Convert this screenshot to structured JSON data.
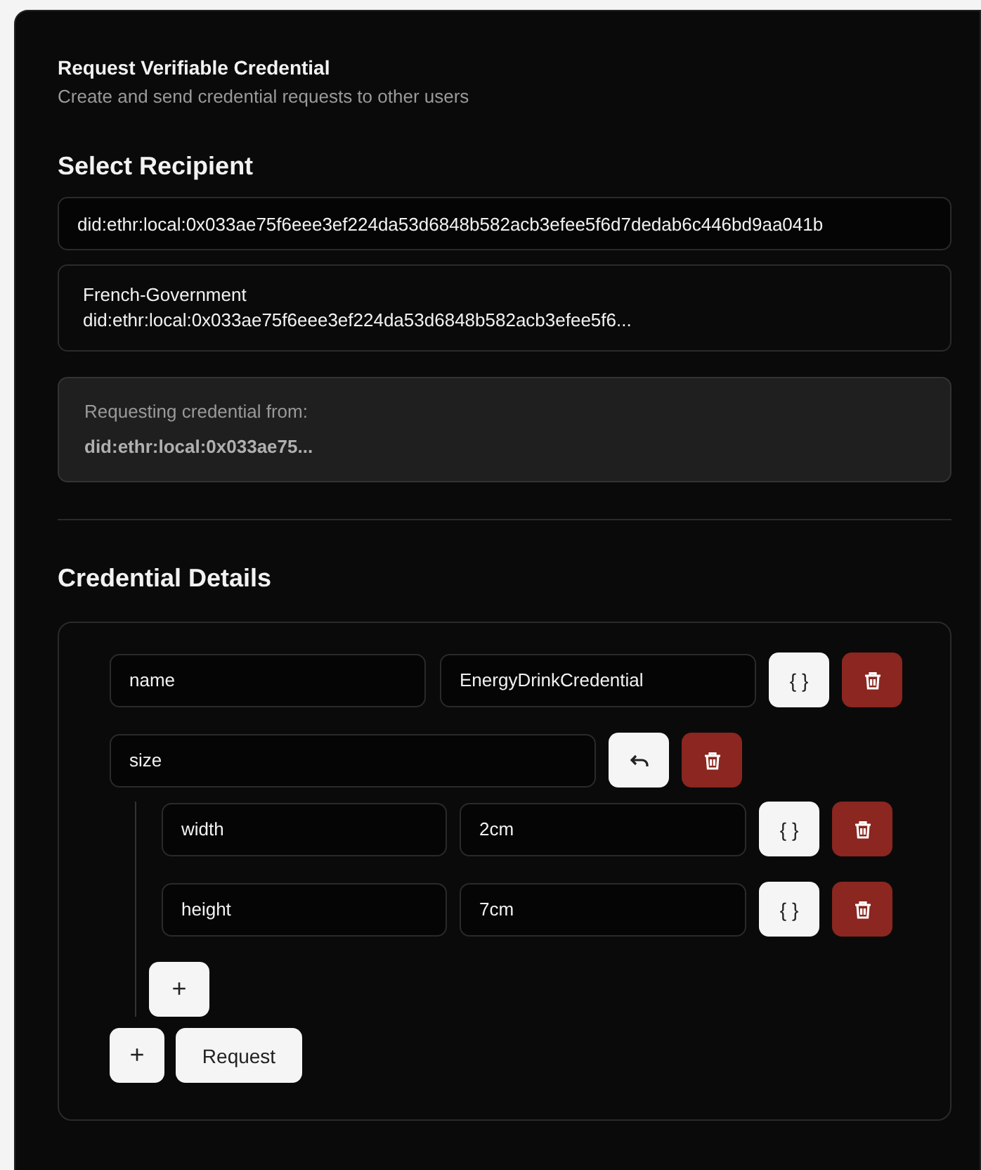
{
  "header": {
    "title": "Request Verifiable Credential",
    "subtitle": "Create and send credential requests to other users"
  },
  "recipient": {
    "heading": "Select Recipient",
    "input_value": "did:ethr:local:0x033ae75f6eee3ef224da53d6848b582acb3efee5f6d7dedab6c446bd9aa041b",
    "option": {
      "name": "French-Government",
      "did": "did:ethr:local:0x033ae75f6eee3ef224da53d6848b582acb3efee5f6..."
    },
    "info_label": "Requesting credential from:",
    "info_value": "did:ethr:local:0x033ae75..."
  },
  "details": {
    "heading": "Credential Details",
    "fields": [
      {
        "kind": "pair",
        "key": "name",
        "value": "EnergyDrinkCredential",
        "type_button": "{ }"
      },
      {
        "kind": "object",
        "key": "size",
        "add_button": "+",
        "children": [
          {
            "kind": "pair",
            "key": "width",
            "value": "2cm",
            "type_button": "{ }"
          },
          {
            "kind": "pair",
            "key": "height",
            "value": "7cm",
            "type_button": "{ }"
          }
        ]
      }
    ],
    "add_button": "+",
    "submit_button": "Request"
  }
}
